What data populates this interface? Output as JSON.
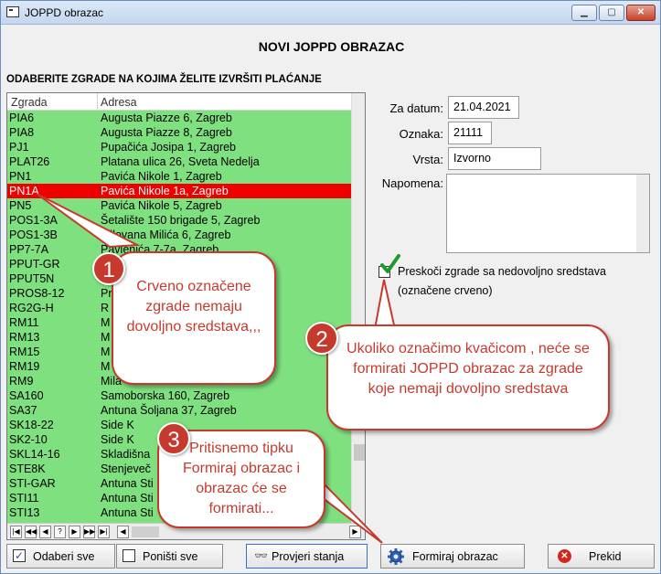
{
  "window": {
    "title": "JOPPD obrazac"
  },
  "heading": "NOVI JOPPD OBRAZAC",
  "subheading": "ODABERITE ZGRADE NA KOJIMA ŽELITE IZVRŠITI PLAĆANJE",
  "grid": {
    "columns": [
      "Zgrada",
      "Adresa"
    ],
    "rows": [
      {
        "zgrada": "PIA6",
        "adresa": "Augusta Piazze 6, Zagreb",
        "red": false
      },
      {
        "zgrada": "PIA8",
        "adresa": "Augusta Piazze 8, Zagreb",
        "red": false
      },
      {
        "zgrada": "PJ1",
        "adresa": "Pupačića Josipa 1, Zagreb",
        "red": false
      },
      {
        "zgrada": "PLAT26",
        "adresa": "Platana ulica 26, Sveta Nedelja",
        "red": false
      },
      {
        "zgrada": "PN1",
        "adresa": "Pavića Nikole 1, Zagreb",
        "red": false
      },
      {
        "zgrada": "PN1A",
        "adresa": "Pavića Nikole 1a, Zagreb",
        "red": true
      },
      {
        "zgrada": "PN5",
        "adresa": "Pavića Nikole 5, Zagreb",
        "red": false
      },
      {
        "zgrada": "POS1-3A",
        "adresa": "Šetalište 150 brigade 5, Zagreb",
        "red": false
      },
      {
        "zgrada": "POS1-3B",
        "adresa": "Milovana Milića 6, Zagreb",
        "red": false
      },
      {
        "zgrada": "PP7-7A",
        "adresa": "Pavlenića 7-7a, Zagreb",
        "red": false
      },
      {
        "zgrada": "PPUT-GR",
        "adresa": "",
        "red": false
      },
      {
        "zgrada": "PPUT5N",
        "adresa": "",
        "red": false
      },
      {
        "zgrada": "PROS8-12",
        "adresa": "Pr",
        "red": false
      },
      {
        "zgrada": "RG2G-H",
        "adresa": "R",
        "red": false
      },
      {
        "zgrada": "RM11",
        "adresa": "M",
        "red": false
      },
      {
        "zgrada": "RM13",
        "adresa": "M",
        "red": false
      },
      {
        "zgrada": "RM15",
        "adresa": "M",
        "red": false
      },
      {
        "zgrada": "RM19",
        "adresa": "M",
        "red": false
      },
      {
        "zgrada": "RM9",
        "adresa": "Mila",
        "red": false
      },
      {
        "zgrada": "SA160",
        "adresa": "Samoborska 160, Zagreb",
        "red": false
      },
      {
        "zgrada": "SA37",
        "adresa": "Antuna Šoljana 37, Zagreb",
        "red": false
      },
      {
        "zgrada": "SK18-22",
        "adresa": "Side K",
        "red": false
      },
      {
        "zgrada": "SK2-10",
        "adresa": "Side K",
        "red": false
      },
      {
        "zgrada": "SKL14-16",
        "adresa": "Skladišna",
        "red": false
      },
      {
        "zgrada": "STE8K",
        "adresa": "Stenjeveč",
        "red": false
      },
      {
        "zgrada": "STI-GAR",
        "adresa": "Antuna Sti",
        "red": false
      },
      {
        "zgrada": "STI11",
        "adresa": "Antuna Sti",
        "red": false
      },
      {
        "zgrada": "STI13",
        "adresa": "Antuna Sti",
        "red": false
      }
    ],
    "nav_buttons": [
      "|◀",
      "◀◀",
      "◀",
      "?",
      "▶",
      "▶▶",
      "▶|"
    ]
  },
  "form": {
    "za_datum_label": "Za datum:",
    "za_datum_value": "21.04.2021",
    "oznaka_label": "Oznaka:",
    "oznaka_value": "21111",
    "vrsta_label": "Vrsta:",
    "vrsta_value": "Izvorno",
    "napomena_label": "Napomena:",
    "preskoci_label": "Preskoči zgrade sa nedovoljno sredstava",
    "preskoci_sub": "(označene crveno)"
  },
  "buttons": {
    "odaberi_sve": "Odaberi sve",
    "ponisti_sve": "Poništi sve",
    "provjeri_stanja": "Provjeri stanja",
    "formiraj_obrazac": "Formiraj obrazac",
    "prekid": "Prekid"
  },
  "callouts": {
    "c1_num": "1",
    "c1_text": "Crveno označene zgrade nemaju dovoljno sredstava,,,",
    "c2_num": "2",
    "c2_text": "Ukoliko označimo kvačicom , neće se formirati JOPPD obrazac za zgrade koje nemaji dovoljno sredstava",
    "c3_num": "3",
    "c3_text": "Pritisnemo tipku Formiraj obrazac i obrazac će se formirati..."
  },
  "colors": {
    "row_ok": "#7fe07f",
    "row_red": "#ee0000",
    "callout": "#c63a2e"
  }
}
